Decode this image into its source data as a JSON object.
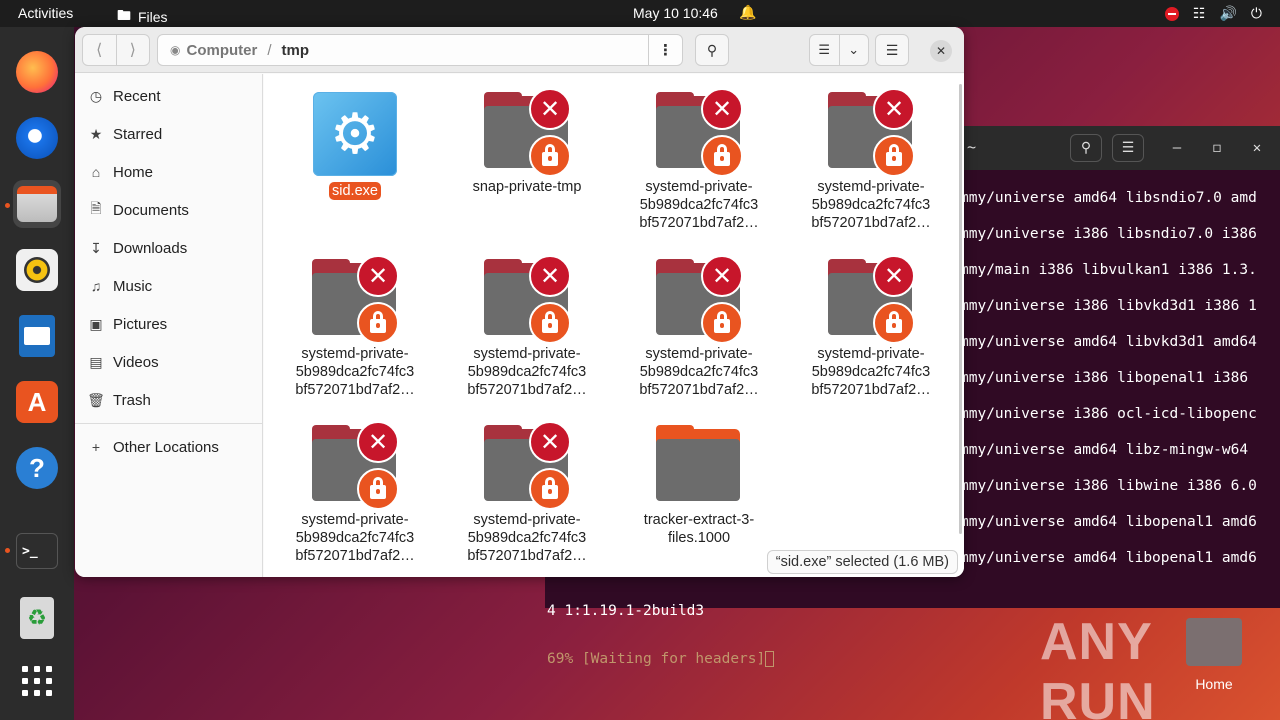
{
  "topbar": {
    "activities": "Activities",
    "app_name": "Files",
    "clock": "May 10  10:46"
  },
  "dock": {
    "items": [
      {
        "name": "Firefox",
        "icon": "firefox-icon"
      },
      {
        "name": "Thunderbird",
        "icon": "thunderbird-icon"
      },
      {
        "name": "Files",
        "icon": "files-icon",
        "active": true
      },
      {
        "name": "Rhythmbox",
        "icon": "rhythmbox-icon"
      },
      {
        "name": "LibreOffice Writer",
        "icon": "writer-icon"
      },
      {
        "name": "Ubuntu Software",
        "icon": "software-icon"
      },
      {
        "name": "Help",
        "icon": "help-icon"
      },
      {
        "name": "Terminal",
        "icon": "terminal-icon"
      },
      {
        "name": "Trash",
        "icon": "trash-icon"
      },
      {
        "name": "Show Applications",
        "icon": "app-grid-icon"
      }
    ]
  },
  "files": {
    "path": [
      "Computer",
      "tmp"
    ],
    "sidebar": [
      {
        "label": "Recent",
        "icon": "clock-icon"
      },
      {
        "label": "Starred",
        "icon": "star-icon"
      },
      {
        "label": "Home",
        "icon": "home-icon"
      },
      {
        "label": "Documents",
        "icon": "document-icon"
      },
      {
        "label": "Downloads",
        "icon": "download-icon"
      },
      {
        "label": "Music",
        "icon": "music-icon"
      },
      {
        "label": "Pictures",
        "icon": "picture-icon"
      },
      {
        "label": "Videos",
        "icon": "video-icon"
      },
      {
        "label": "Trash",
        "icon": "trash-icon"
      }
    ],
    "other_locations": "Other Locations",
    "items": [
      {
        "line1": "sid.exe",
        "line2": "",
        "line3": "",
        "type": "exe",
        "selected": true
      },
      {
        "line1": "snap-private-tmp",
        "line2": "",
        "line3": "",
        "type": "locked-folder"
      },
      {
        "line1": "systemd-private-",
        "line2": "5b989dca2fc74fc3",
        "line3": "bf572071bd7af2…",
        "type": "locked-folder"
      },
      {
        "line1": "systemd-private-",
        "line2": "5b989dca2fc74fc3",
        "line3": "bf572071bd7af2…",
        "type": "locked-folder"
      },
      {
        "line1": "systemd-private-",
        "line2": "5b989dca2fc74fc3",
        "line3": "bf572071bd7af2…",
        "type": "locked-folder"
      },
      {
        "line1": "systemd-private-",
        "line2": "5b989dca2fc74fc3",
        "line3": "bf572071bd7af2…",
        "type": "locked-folder"
      },
      {
        "line1": "systemd-private-",
        "line2": "5b989dca2fc74fc3",
        "line3": "bf572071bd7af2…",
        "type": "locked-folder"
      },
      {
        "line1": "systemd-private-",
        "line2": "5b989dca2fc74fc3",
        "line3": "bf572071bd7af2…",
        "type": "locked-folder"
      },
      {
        "line1": "systemd-private-",
        "line2": "5b989dca2fc74fc3",
        "line3": "bf572071bd7af2…",
        "type": "locked-folder"
      },
      {
        "line1": "systemd-private-",
        "line2": "5b989dca2fc74fc3",
        "line3": "bf572071bd7af2…",
        "type": "locked-folder"
      },
      {
        "line1": "tracker-extract-3-",
        "line2": "files.1000",
        "line3": "",
        "type": "folder"
      }
    ],
    "status": "“sid.exe” selected (1.6 MB)"
  },
  "terminal": {
    "title": "~",
    "lines": [
      "mmy/universe amd64 libsndio7.0 amd",
      "mmy/universe i386 libsndio7.0 i386",
      "mmy/main i386 libvulkan1 i386 1.3.",
      "mmy/universe i386 libvkd3d1 i386 1",
      "mmy/universe amd64 libvkd3d1 amd64",
      "mmy/universe i386 libopenal1 i386",
      "mmy/universe i386 ocl-icd-libopenc",
      "mmy/universe amd64 libz-mingw-w64",
      "mmy/universe i386 libwine i386 6.0",
      "mmy/universe amd64 libopenal1 amd6",
      "mmy/universe amd64 libopenal1 amd6"
    ],
    "bottom_line1": "4 1:1.19.1-2build3",
    "bottom_line2": "69% [Waiting for headers]"
  },
  "desktop": {
    "home_label": "Home",
    "watermark": "ANY RUN"
  },
  "colors": {
    "accent": "#e95420",
    "error": "#c7162b",
    "folder_front": "#6c6c6c",
    "folder_back": "#a8323e"
  }
}
